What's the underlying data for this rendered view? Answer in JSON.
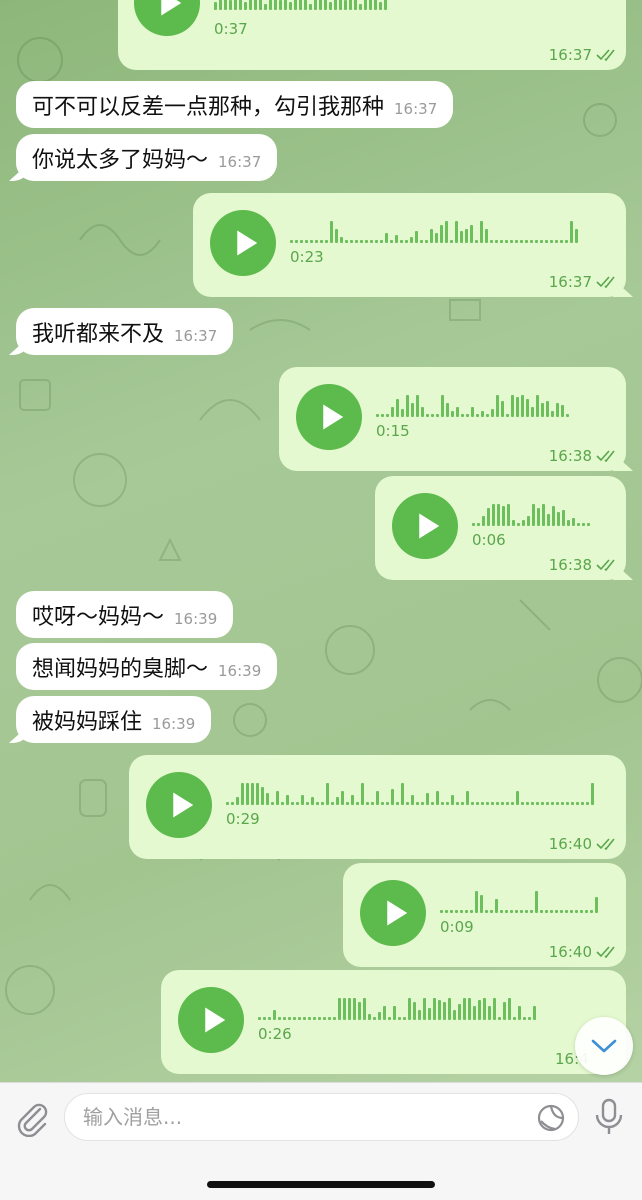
{
  "colors": {
    "accent": "#5dba4c",
    "outgoing": "#e4f9cf",
    "incoming": "#ffffff"
  },
  "messages": [
    {
      "kind": "voice",
      "duration": "0:37",
      "time": "16:37"
    },
    {
      "kind": "text",
      "text": "可不可以反差一点那种，勾引我那种",
      "time": "16:37"
    },
    {
      "kind": "text",
      "text": "你说太多了妈妈～",
      "time": "16:37"
    },
    {
      "kind": "voice",
      "duration": "0:23",
      "time": "16:37"
    },
    {
      "kind": "text",
      "text": "我听都来不及",
      "time": "16:37"
    },
    {
      "kind": "voice",
      "duration": "0:15",
      "time": "16:38"
    },
    {
      "kind": "voice",
      "duration": "0:06",
      "time": "16:38"
    },
    {
      "kind": "text",
      "text": "哎呀～妈妈～",
      "time": "16:39"
    },
    {
      "kind": "text",
      "text": "想闻妈妈的臭脚～",
      "time": "16:39"
    },
    {
      "kind": "text",
      "text": "被妈妈踩住",
      "time": "16:39"
    },
    {
      "kind": "voice",
      "duration": "0:29",
      "time": "16:40"
    },
    {
      "kind": "voice",
      "duration": "0:09",
      "time": "16:40"
    },
    {
      "kind": "voice",
      "duration": "0:26",
      "time": "16:4"
    }
  ],
  "input": {
    "placeholder": "输入消息..."
  },
  "icons": {
    "attach": "paperclip-icon",
    "sticker": "sticker-icon",
    "mic": "microphone-icon",
    "scroll": "chevron-down-icon",
    "play": "play-icon",
    "read": "double-check-icon"
  }
}
